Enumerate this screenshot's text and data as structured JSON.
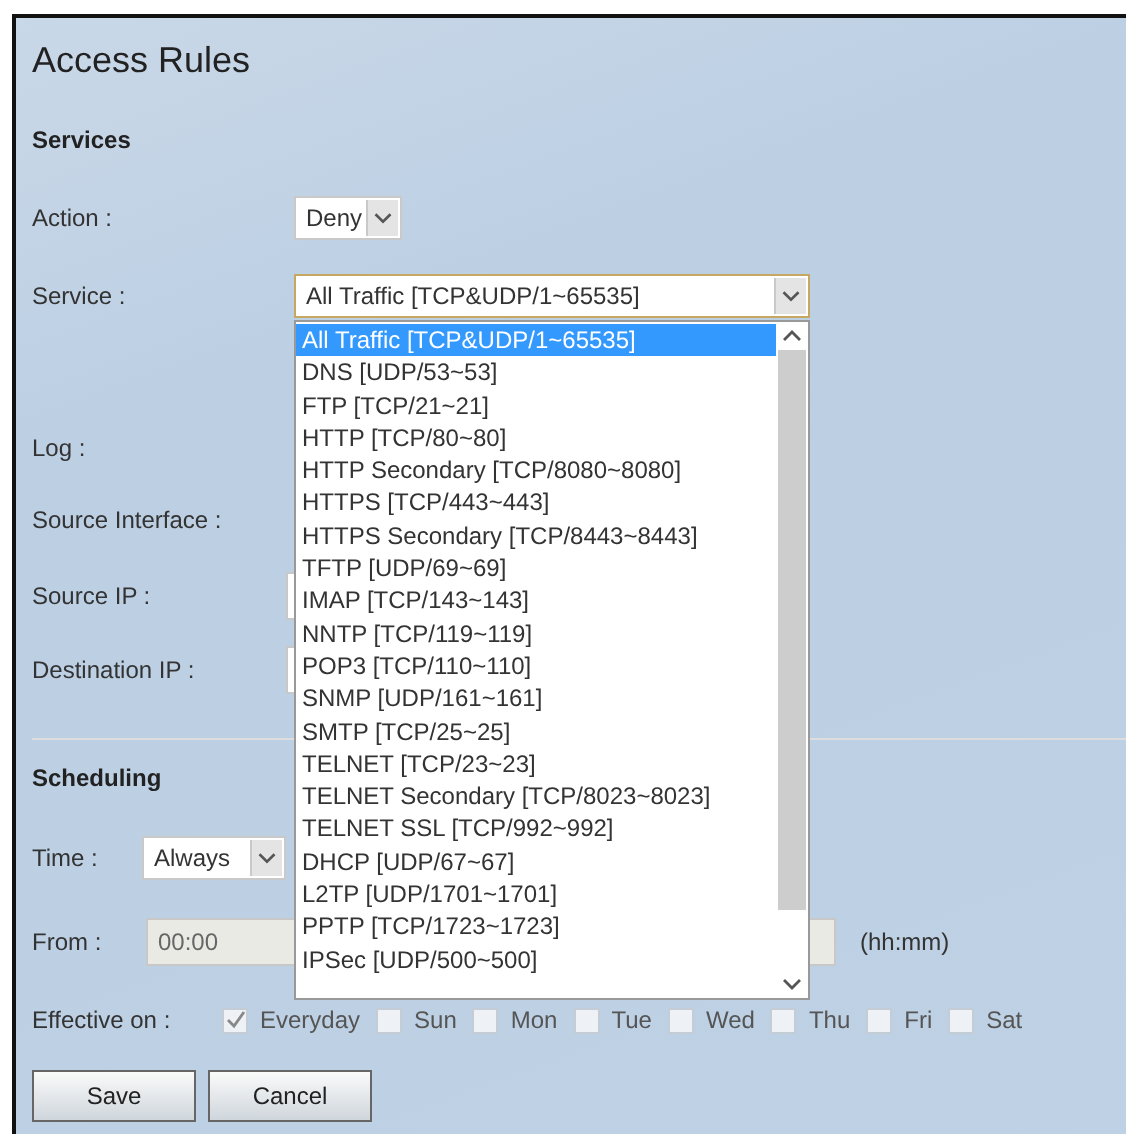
{
  "title": "Access Rules",
  "services": {
    "heading": "Services",
    "action": {
      "label": "Action :",
      "value": "Deny"
    },
    "service": {
      "label": "Service :",
      "value": "All Traffic [TCP&UDP/1~65535]",
      "options": [
        {
          "label": "All Traffic [TCP&UDP/1~65535]",
          "selected": true
        },
        {
          "label": "DNS [UDP/53~53]",
          "selected": false
        },
        {
          "label": "FTP [TCP/21~21]",
          "selected": false
        },
        {
          "label": "HTTP [TCP/80~80]",
          "selected": false
        },
        {
          "label": "HTTP Secondary [TCP/8080~8080]",
          "selected": false
        },
        {
          "label": "HTTPS [TCP/443~443]",
          "selected": false
        },
        {
          "label": "HTTPS Secondary [TCP/8443~8443]",
          "selected": false
        },
        {
          "label": "TFTP [UDP/69~69]",
          "selected": false
        },
        {
          "label": "IMAP [TCP/143~143]",
          "selected": false
        },
        {
          "label": "NNTP [TCP/119~119]",
          "selected": false
        },
        {
          "label": "POP3 [TCP/110~110]",
          "selected": false
        },
        {
          "label": "SNMP [UDP/161~161]",
          "selected": false
        },
        {
          "label": "SMTP [TCP/25~25]",
          "selected": false
        },
        {
          "label": "TELNET [TCP/23~23]",
          "selected": false
        },
        {
          "label": "TELNET Secondary [TCP/8023~8023]",
          "selected": false
        },
        {
          "label": "TELNET SSL [TCP/992~992]",
          "selected": false
        },
        {
          "label": "DHCP [UDP/67~67]",
          "selected": false
        },
        {
          "label": "L2TP [UDP/1701~1701]",
          "selected": false
        },
        {
          "label": "PPTP [TCP/1723~1723]",
          "selected": false
        },
        {
          "label": "IPSec [UDP/500~500]",
          "selected": false
        }
      ]
    },
    "log": {
      "label": "Log :"
    },
    "source_interface": {
      "label": "Source Interface :"
    },
    "source_ip": {
      "label": "Source IP :"
    },
    "destination_ip": {
      "label": "Destination IP :"
    }
  },
  "scheduling": {
    "heading": "Scheduling",
    "time": {
      "label": "Time :",
      "value": "Always"
    },
    "from": {
      "label": "From :",
      "value": "00:00",
      "unit": "(hh:mm)"
    },
    "effective_on": {
      "label": "Effective on :",
      "days": [
        {
          "label": "Everyday",
          "checked": true
        },
        {
          "label": "Sun",
          "checked": false
        },
        {
          "label": "Mon",
          "checked": false
        },
        {
          "label": "Tue",
          "checked": false
        },
        {
          "label": "Wed",
          "checked": false
        },
        {
          "label": "Thu",
          "checked": false
        },
        {
          "label": "Fri",
          "checked": false
        },
        {
          "label": "Sat",
          "checked": false
        }
      ]
    }
  },
  "buttons": [
    "Save",
    "Cancel"
  ]
}
